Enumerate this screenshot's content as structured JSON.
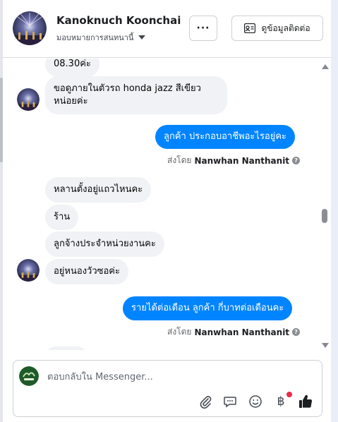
{
  "header": {
    "contact_name": "Kanoknuch Koonchai",
    "assign_label": "มอบหมายการสนทนานี้",
    "more_label": "···",
    "view_info_label": "ดูข้อมูลติดต่อ"
  },
  "messages": [
    {
      "side": "in",
      "text": "08.30ค่ะ",
      "avatar": false
    },
    {
      "side": "in",
      "text": "ขอดูภายในตัวรถ honda jazz สีเขียว",
      "text2": "หน่อยค่ะ",
      "avatar": true
    },
    {
      "side": "out",
      "text": "ลูกค้า  ประกอบอาชีพอะไรอยู่คะ"
    },
    {
      "side": "sentby",
      "prefix": "ส่งโดย",
      "agent": "Nanwhan Nanthanit"
    },
    {
      "side": "in",
      "text": "หลานตั้งอยู่แถวไหนคะ",
      "avatar": false
    },
    {
      "side": "in",
      "text": "ร้าน",
      "avatar": false
    },
    {
      "side": "in",
      "text": "ลูกจ้างประจำหน่วยงานคะ",
      "avatar": false
    },
    {
      "side": "in",
      "text": "อยู่หนองวัวซอค่ะ",
      "avatar": true
    },
    {
      "side": "out",
      "text": "รายได้ต่อเดือน ลูกค้า   กี่บาทต่อเดือนคะ"
    },
    {
      "side": "sentby",
      "prefix": "ส่งโดย",
      "agent": "Nanwhan Nanthanit"
    }
  ],
  "composer": {
    "placeholder": "ตอบกลับใน Messenger...",
    "tools": [
      "paperclip-icon",
      "saved-reply-icon",
      "emoji-icon",
      "baht-payment-icon",
      "thumbs-up-icon"
    ]
  },
  "colors": {
    "outgoing_bubble": "#0084ff",
    "incoming_bubble": "#f0f2f5",
    "notification_dot": "#f02849"
  }
}
